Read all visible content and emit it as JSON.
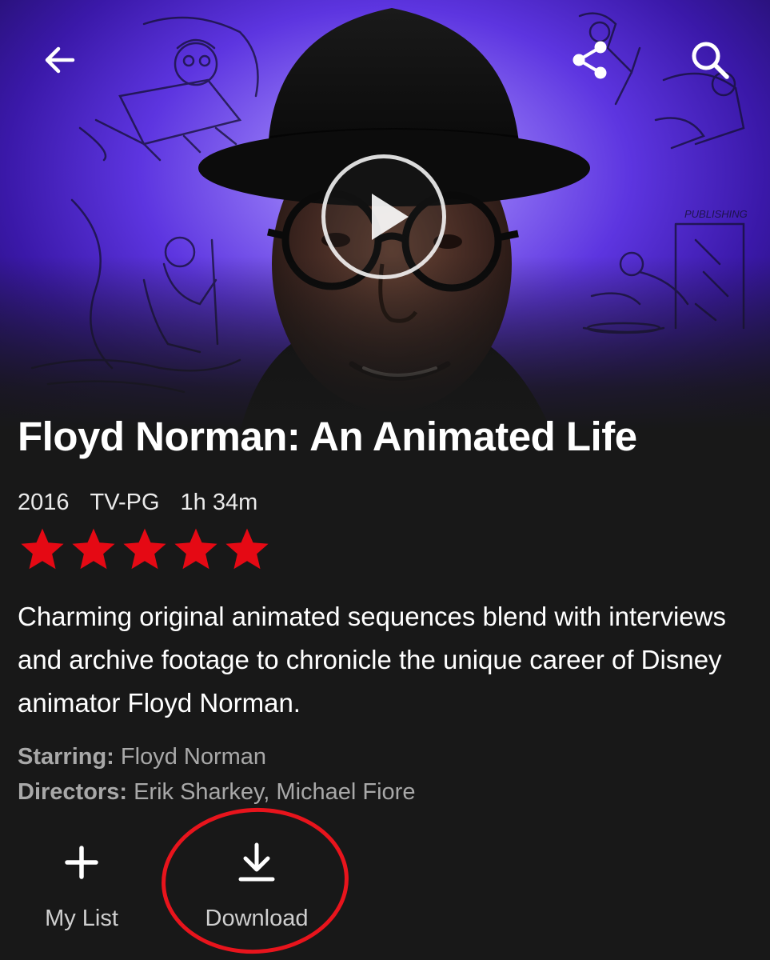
{
  "nav": {
    "back_icon": "arrow-left-icon",
    "share_icon": "share-icon",
    "search_icon": "search-icon"
  },
  "hero": {
    "play_icon": "play-icon",
    "sketch_caption": "PUBLISHING"
  },
  "title": "Floyd Norman: An Animated Life",
  "meta": {
    "year": "2016",
    "rating": "TV-PG",
    "duration": "1h 34m"
  },
  "user_rating": {
    "stars": 5,
    "max": 5
  },
  "synopsis": "Charming original animated sequences blend with interviews and archive footage to chronicle the unique career of Disney animator Floyd Norman.",
  "credits": {
    "starring_label": "Starring:",
    "starring": "Floyd Norman",
    "directors_label": "Directors:",
    "directors": "Erik Sharkey, Michael Fiore"
  },
  "actions": {
    "my_list_label": "My List",
    "my_list_icon": "plus-icon",
    "download_label": "Download",
    "download_icon": "download-icon"
  },
  "colors": {
    "background": "#181818",
    "star": "#e50914",
    "hero_purple": "#5d35e0",
    "annotation": "#e8141c"
  }
}
